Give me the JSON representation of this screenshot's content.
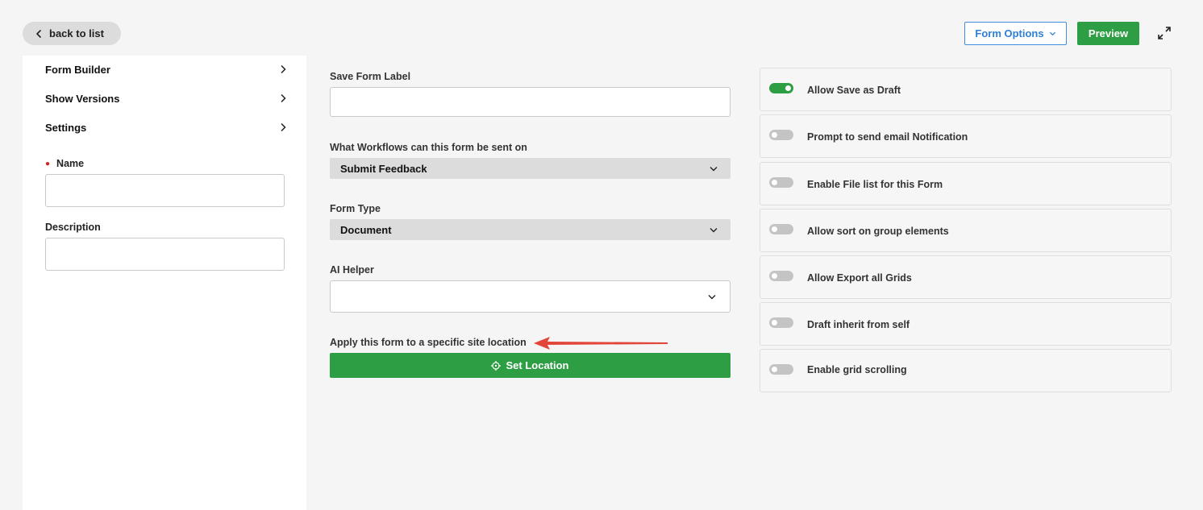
{
  "topbar": {
    "back_label": "back to list",
    "form_options_label": "Form Options",
    "preview_label": "Preview"
  },
  "sidebar": {
    "nav": [
      {
        "label": "Form Builder"
      },
      {
        "label": "Show Versions"
      },
      {
        "label": "Settings"
      }
    ],
    "name_label": "Name",
    "name_value": "",
    "description_label": "Description",
    "description_value": ""
  },
  "main": {
    "save_form_label": "Save Form Label",
    "save_form_value": "",
    "workflows_label": "What Workflows can this form be sent on",
    "workflows_value": "Submit Feedback",
    "form_type_label": "Form Type",
    "form_type_value": "Document",
    "ai_helper_label": "AI Helper",
    "ai_helper_value": "",
    "apply_location_label": "Apply this form to a specific site location",
    "set_location_label": "Set Location"
  },
  "toggles": [
    {
      "label": "Allow Save as Draft",
      "on": true
    },
    {
      "label": "Prompt to send email Notification",
      "on": false
    },
    {
      "label": "Enable File list for this Form",
      "on": false
    },
    {
      "label": "Allow sort on group elements",
      "on": false
    },
    {
      "label": "Allow Export all Grids",
      "on": false
    },
    {
      "label": "Draft inherit from self",
      "on": false
    },
    {
      "label": "Enable grid scrolling",
      "on": false
    }
  ],
  "colors": {
    "accent_green": "#2e9e44",
    "accent_blue": "#2d7fd6",
    "required_red": "#d0261c",
    "annotation_arrow": "#e2463a"
  }
}
